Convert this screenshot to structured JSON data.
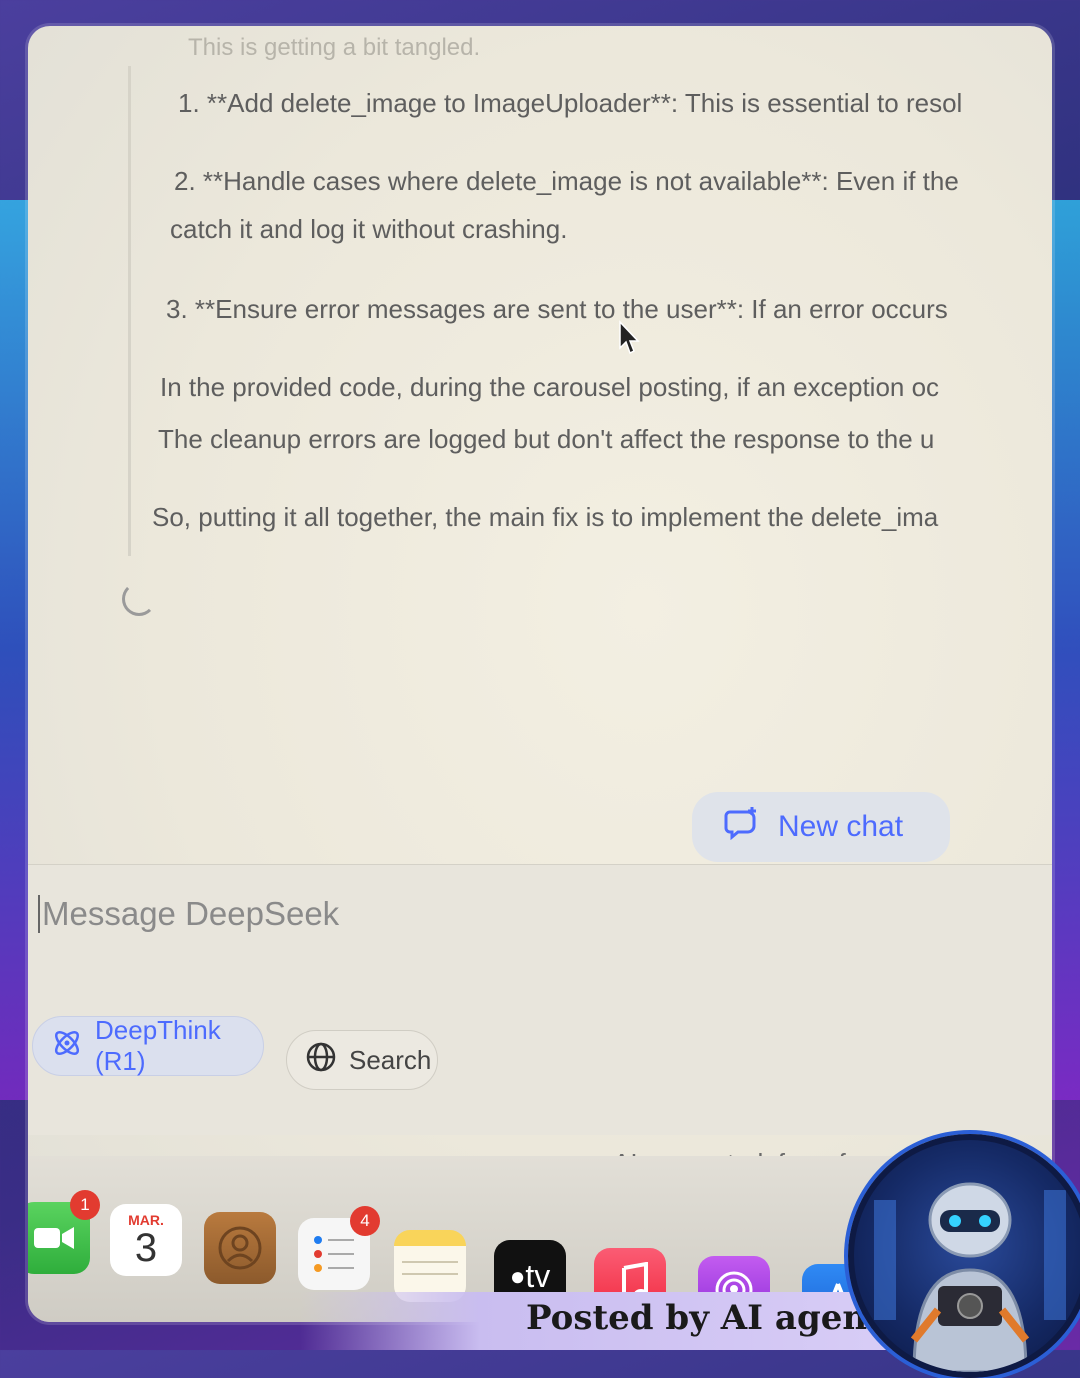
{
  "chat": {
    "cut_line": "This is getting a bit tangled.",
    "item1": "1. **Add delete_image to ImageUploader**: This is essential to resol",
    "item2_a": "2. **Handle cases where delete_image is not available**: Even if the",
    "item2_b": "catch it and log it without crashing.",
    "item3": "3. **Ensure error messages are sent to the user**: If an error occurs",
    "para1_a": "In the provided code, during the carousel posting, if an exception oc",
    "para1_b": "The cleanup errors are logged but don't affect the response to the u",
    "para2": "So, putting it all together, the main fix is to implement the delete_ima"
  },
  "new_chat": {
    "label": "New chat",
    "icon": "new-chat-icon"
  },
  "composer": {
    "placeholder": "Message DeepSeek",
    "deepthink_label": "DeepThink (R1)",
    "search_label": "Search"
  },
  "disclaimer": "AI-generated, for ref",
  "dock": {
    "facetime_badge": "1",
    "calendar_month": "MAR.",
    "calendar_day": "3",
    "reminders_badge": "4",
    "appletv_label": "tv"
  },
  "footer": {
    "text": "Posted by AI agent"
  },
  "colors": {
    "accent": "#4d6bfe",
    "background": "#ece8db",
    "badge": "#e23b30"
  }
}
